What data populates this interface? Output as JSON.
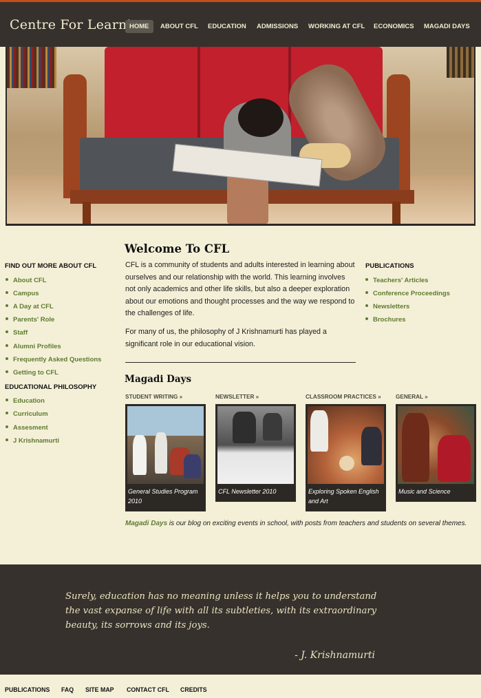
{
  "header": {
    "logo": "Centre For Learning",
    "nav": [
      "HOME",
      "ABOUT CFL",
      "EDUCATION",
      "ADMISSIONS",
      "WORKING AT CFL",
      "ECONOMICS",
      "MAGADI DAYS"
    ],
    "active": "HOME"
  },
  "sidebar": {
    "heading_about": "FIND OUT MORE ABOUT CFL",
    "about_links": [
      "About CFL",
      "Campus",
      "A Day at CFL",
      "Parents' Role",
      "Staff",
      "Alumni Profiles",
      "Frequently Asked Questions",
      "Getting to CFL"
    ],
    "heading_philosophy": "EDUCATIONAL PHILOSOPHY",
    "philosophy_links": [
      "Education",
      "Curriculum",
      "Assesment",
      "J Krishnamurti"
    ]
  },
  "main": {
    "title": "Welcome To CFL",
    "para1": "CFL is a community of students and adults interested in learning about ourselves and our relationship with the world. This learning involves not only academics and other life skills, but also a deeper exploration about our emotions and thought processes and the way we respond to the challenges of life.",
    "para2": "For many of us, the philosophy of J Krishnamurti has played a significant role in our educational vision.",
    "magadi_title": "Magadi Days",
    "cards": [
      {
        "label": "STUDENT WRITING »",
        "caption": "General Studies Program 2010"
      },
      {
        "label": "NEWSLETTER »",
        "caption": "CFL Newsletter 2010"
      },
      {
        "label": "CLASSROOM PRACTICES »",
        "caption": "Exploring Spoken English and Art"
      },
      {
        "label": "GENERAL »",
        "caption": "Music and Science"
      }
    ],
    "blog_link": "Magadi Days",
    "blog_text": " is our blog on exciting events in school, with posts from teachers and students on several themes."
  },
  "publications": {
    "heading": "PUBLICATIONS",
    "links": [
      "Teachers' Articles",
      "Conference Proceedings",
      "Newsletters",
      "Brochures"
    ]
  },
  "quote": {
    "text": "Surely, education has no meaning unless it helps you to understand the vast expanse of life with all its subtleties, with its extraordinary beauty, its sorrows and its joys.",
    "author": "- J. Krishnamurti"
  },
  "footer": {
    "links": [
      "PUBLICATIONS",
      "FAQ",
      "SITE MAP",
      "CONTACT CFL",
      "CREDITS"
    ]
  },
  "colors": {
    "header_bg": "#36312d",
    "page_bg": "#f4f0d8",
    "accent_top": "#c4501a",
    "link_green": "#5f7a2f",
    "quote_text": "#ebe4bf"
  }
}
